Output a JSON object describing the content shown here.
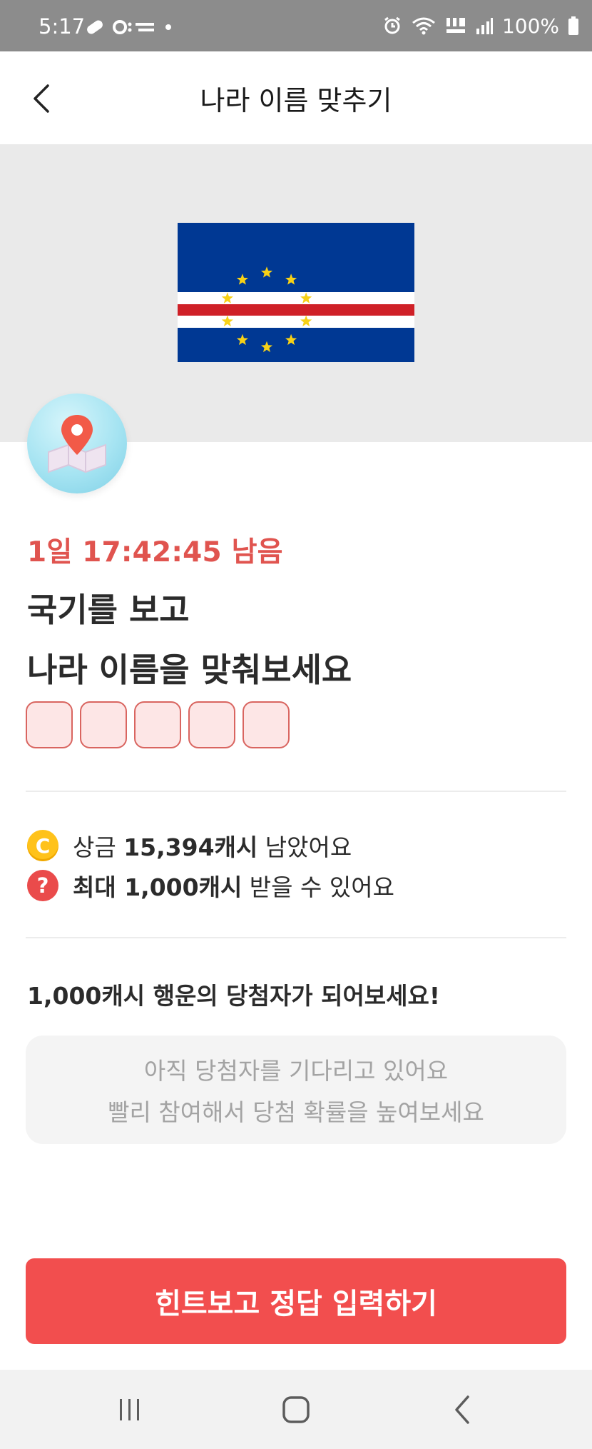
{
  "status_bar": {
    "time": "5:17",
    "battery": "100%"
  },
  "header": {
    "title": "나라 이름 맞추기"
  },
  "quiz": {
    "flag_country_icon": "cape-verde-flag",
    "timer": "1일 17:42:45 남음",
    "question_line1": "국기를 보고",
    "question_line2": "나라 이름을 맞춰보세요",
    "answer_box_count": 5
  },
  "prize": {
    "remaining_prefix": "상금 ",
    "remaining_amount": "15,394캐시",
    "remaining_suffix": " 남았어요",
    "max_amount": "최대 1,000캐시",
    "max_suffix": " 받을 수 있어요"
  },
  "lucky": {
    "title": "1,000캐시 행운의 당첨자가 되어보세요!",
    "waiting_line1": "아직 당첨자를 기다리고 있어요",
    "waiting_line2": "빨리 참여해서 당첨 확률을 높여보세요"
  },
  "cta": {
    "label": "힌트보고 정답 입력하기"
  },
  "colors": {
    "accent": "#f24e4e",
    "timer": "#e0544f",
    "coin": "#ffc21a"
  }
}
